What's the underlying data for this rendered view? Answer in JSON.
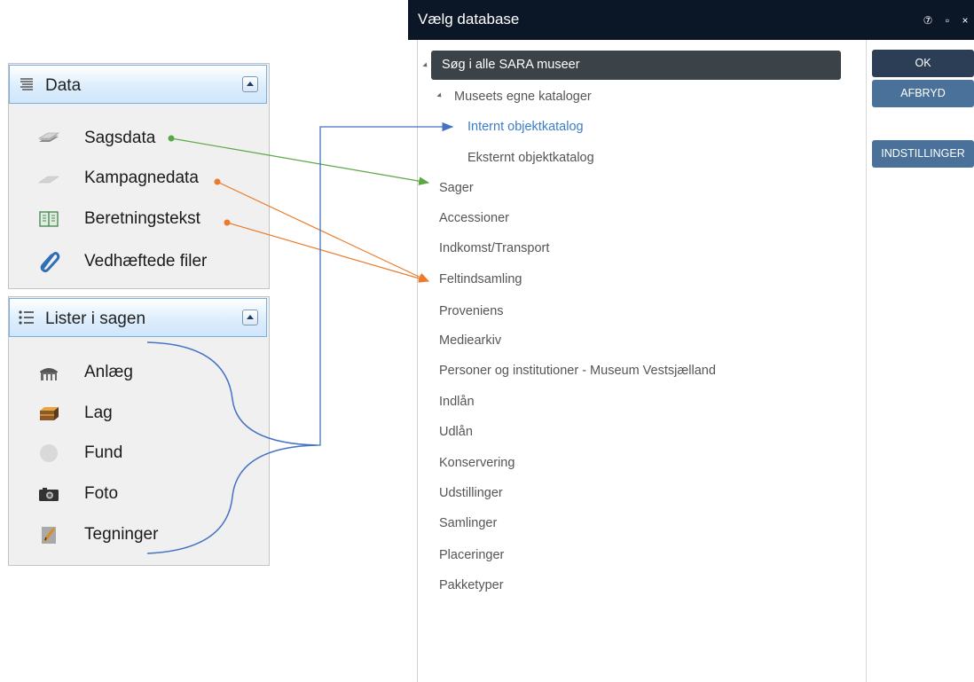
{
  "left_panels": {
    "data": {
      "title": "Data",
      "items": [
        {
          "label": "Sagsdata",
          "icon": "stack-layers-icon"
        },
        {
          "label": "Kampagnedata",
          "icon": "flat-layer-icon"
        },
        {
          "label": "Beretningstekst",
          "icon": "book-icon"
        },
        {
          "label": "Vedhæftede filer",
          "icon": "paperclip-icon"
        }
      ]
    },
    "lister": {
      "title": "Lister i sagen",
      "items": [
        {
          "label": "Anlæg",
          "icon": "structure-icon"
        },
        {
          "label": "Lag",
          "icon": "layer-block-icon"
        },
        {
          "label": "Fund",
          "icon": "find-circle-icon"
        },
        {
          "label": "Foto",
          "icon": "camera-icon"
        },
        {
          "label": "Tegninger",
          "icon": "drawing-icon"
        }
      ]
    }
  },
  "dialog": {
    "title": "Vælg database",
    "controls": {
      "help": "⑦",
      "maximize": "▫",
      "close": "×"
    },
    "tree": {
      "root": "Søg i alle SARA museer",
      "group": "Museets egne kataloger",
      "sub_items": [
        "Internt objektkatalog",
        "Eksternt objektkatalog"
      ],
      "items": [
        "Sager",
        "Accessioner",
        "Indkomst/Transport",
        "Feltindsamling",
        "Proveniens",
        "Mediearkiv",
        "Personer og institutioner - Museum Vestsjælland",
        "Indlån",
        "Udlån",
        "Konservering",
        "Udstillinger",
        "Samlinger",
        "Placeringer",
        "Pakketyper"
      ]
    },
    "buttons": {
      "ok": "OK",
      "cancel": "AFBRYD",
      "settings": "INDSTILLINGER"
    }
  },
  "colors": {
    "green_arrow": "#5aa844",
    "orange_arrow": "#ec7a2c",
    "blue_connector": "#4472c4",
    "selected_link": "#3d7ec8"
  }
}
